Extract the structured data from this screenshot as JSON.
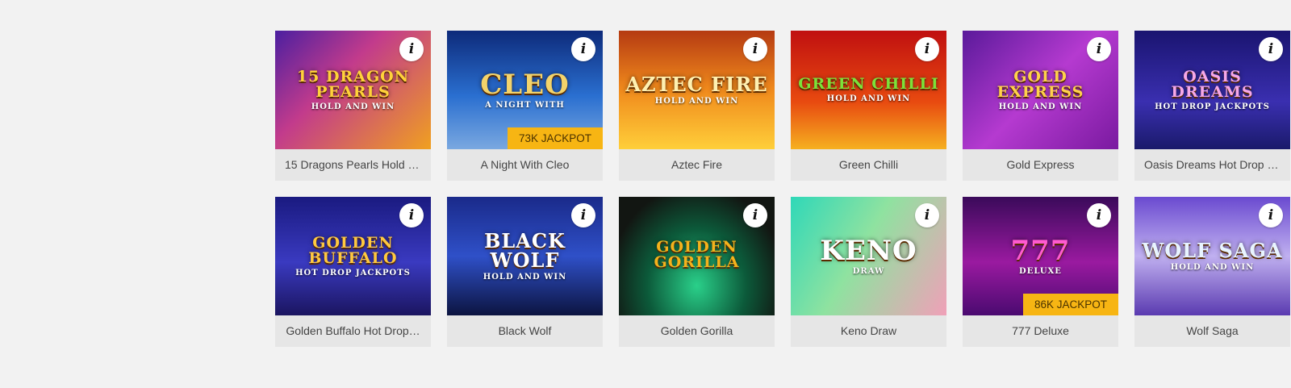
{
  "info_glyph": "i",
  "games": [
    {
      "name": "15 Dragons Pearls Hold a…",
      "logo": "15 DRAGON PEARLS",
      "logo_sub": "HOLD AND WIN",
      "jackpot": "",
      "bg": "linear-gradient(135deg,#4b1fa0 0%,#c23b8c 40%,#f0a020 100%)",
      "logo_color": "#ffd23a"
    },
    {
      "name": "A Night With Cleo",
      "logo": "CLEO",
      "logo_sub": "A NIGHT WITH",
      "jackpot": "73K JACKPOT",
      "bg": "linear-gradient(180deg,#0d2a7a 0%,#2a6fd0 55%,#7aa8e0 100%)",
      "logo_color": "#f3d36b"
    },
    {
      "name": "Aztec Fire",
      "logo": "AZTEC FIRE",
      "logo_sub": "HOLD AND WIN",
      "jackpot": "",
      "bg": "linear-gradient(180deg,#b53a12 0%,#f08a1c 50%,#ffcf3a 100%)",
      "logo_color": "#fff0b0"
    },
    {
      "name": "Green Chilli",
      "logo": "GREEN CHILLI",
      "logo_sub": "HOLD AND WIN",
      "jackpot": "",
      "bg": "linear-gradient(180deg,#c01010 0%,#e84a10 60%,#f6b020 100%)",
      "logo_color": "#7be23a"
    },
    {
      "name": "Gold Express",
      "logo": "GOLD EXPRESS",
      "logo_sub": "HOLD AND WIN",
      "jackpot": "",
      "bg": "linear-gradient(135deg,#5a1a9a 0%,#b53ad0 50%,#7a1aa0 100%)",
      "logo_color": "#ffd24a"
    },
    {
      "name": "Oasis Dreams Hot Drop J…",
      "logo": "OASIS DREAMS",
      "logo_sub": "HOT DROP JACKPOTS",
      "jackpot": "",
      "bg": "linear-gradient(180deg,#1a1470 0%,#3a2fb0 60%,#1a1a6a 100%)",
      "logo_color": "#f6a8e8"
    },
    {
      "name": "Golden Buffalo Hot Drop…",
      "logo": "GOLDEN BUFFALO",
      "logo_sub": "HOT DROP JACKPOTS",
      "jackpot": "",
      "bg": "linear-gradient(180deg,#1a1a80 0%,#3a3ac0 55%,#1b1560 100%)",
      "logo_color": "#ffc940"
    },
    {
      "name": "Black Wolf",
      "logo": "BLACK WOLF",
      "logo_sub": "HOLD AND WIN",
      "jackpot": "",
      "bg": "linear-gradient(180deg,#1a2a8a 0%,#2f50c8 50%,#0c1440 100%)",
      "logo_color": "#ffffff"
    },
    {
      "name": "Golden Gorilla",
      "logo": "GOLDEN GORILLA",
      "logo_sub": "",
      "jackpot": "",
      "bg": "radial-gradient(ellipse at 50% 75%,#2ad08a 0%,#0c5a3a 45%,#121612 80%)",
      "logo_color": "#f5b21c"
    },
    {
      "name": "Keno Draw",
      "logo": "KENO",
      "logo_sub": "DRAW",
      "jackpot": "",
      "bg": "linear-gradient(120deg,#2fd8b8 0%,#8fe2a0 45%,#f0a0b8 100%)",
      "logo_color": "#ffffff"
    },
    {
      "name": "777 Deluxe",
      "logo": "777",
      "logo_sub": "DELUXE",
      "jackpot": "86K JACKPOT",
      "bg": "linear-gradient(180deg,#3a0a5a 0%,#9a1aa0 55%,#4a0a70 100%)",
      "logo_color": "#ff5ad0"
    },
    {
      "name": "Wolf Saga",
      "logo": "WOLF SAGA",
      "logo_sub": "HOLD AND WIN",
      "jackpot": "",
      "bg": "linear-gradient(180deg,#6a4ad0 0%,#c0b0f0 50%,#5a3ab0 100%)",
      "logo_color": "#e8f4ff"
    }
  ]
}
